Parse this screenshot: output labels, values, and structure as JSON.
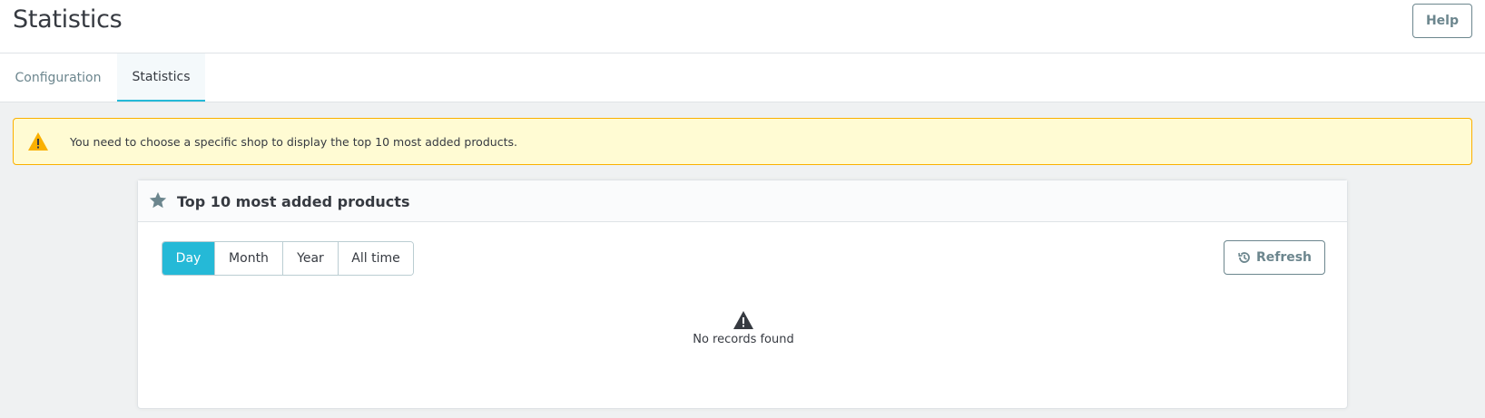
{
  "page": {
    "title": "Statistics",
    "help_label": "Help"
  },
  "tabs": [
    {
      "label": "Configuration",
      "active": false
    },
    {
      "label": "Statistics",
      "active": true
    }
  ],
  "alert": {
    "icon": "warning-icon",
    "text": "You need to choose a specific shop to display the top 10 most added products."
  },
  "card": {
    "icon": "star-icon",
    "title": "Top 10 most added products",
    "periods": [
      {
        "label": "Day",
        "active": true
      },
      {
        "label": "Month",
        "active": false
      },
      {
        "label": "Year",
        "active": false
      },
      {
        "label": "All time",
        "active": false
      }
    ],
    "refresh_label": "Refresh",
    "refresh_icon": "history-icon",
    "empty_icon": "warning-icon",
    "empty_text": "No records found"
  },
  "colors": {
    "accent": "#25b9d7",
    "warning": "#fab000",
    "alert_bg": "#fffbd3",
    "muted": "#6c868e",
    "text": "#363a41"
  }
}
